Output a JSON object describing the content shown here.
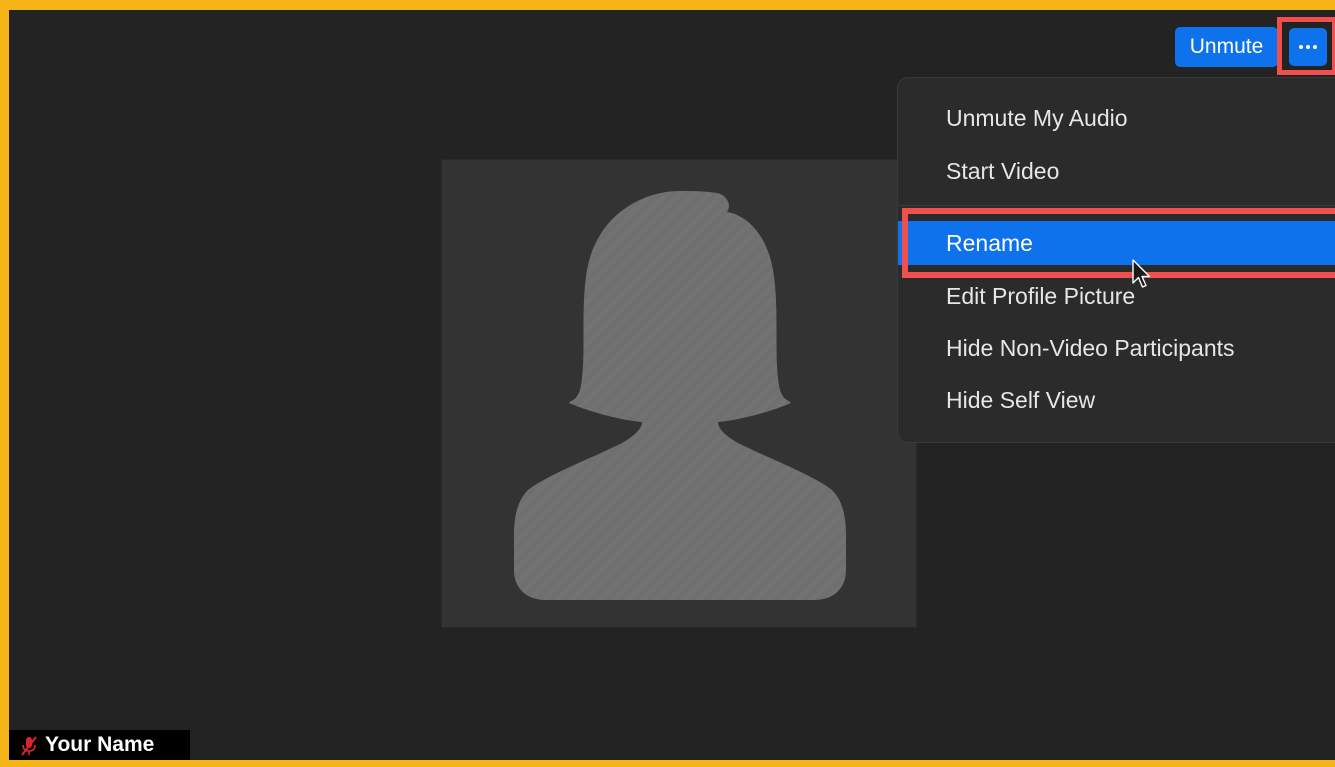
{
  "toolbar": {
    "unmute_label": "Unmute",
    "more_icon": "ellipsis-icon"
  },
  "menu": {
    "items": [
      {
        "label": "Unmute My Audio",
        "selected": false
      },
      {
        "label": "Start Video",
        "selected": false
      },
      {
        "label": "Rename",
        "selected": true
      },
      {
        "label": "Edit Profile Picture",
        "selected": false
      },
      {
        "label": "Hide Non-Video Participants",
        "selected": false
      },
      {
        "label": "Hide Self View",
        "selected": false
      }
    ]
  },
  "participant": {
    "name": "Your Name",
    "mic_icon": "mic-muted-icon",
    "avatar_icon": "person-silhouette-icon"
  },
  "colors": {
    "frame": "#f5b418",
    "accent": "#0e72ed",
    "highlight": "#ef4f4f",
    "background": "#232323",
    "menu_background": "#2b2b2b"
  }
}
